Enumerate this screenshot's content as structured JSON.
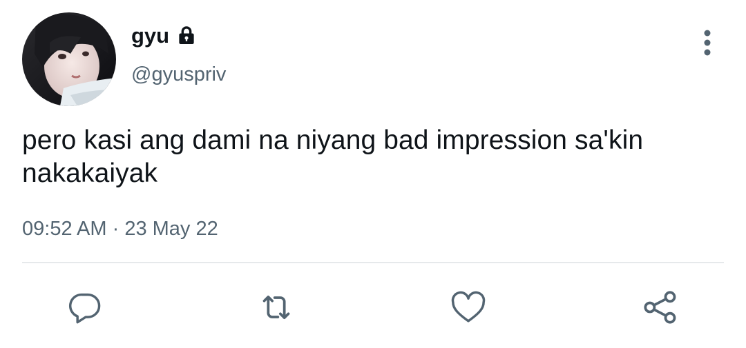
{
  "author": {
    "display_name": "gyu",
    "handle": "@gyuspriv",
    "protected": true,
    "avatar_icon": "avatar-photo"
  },
  "tweet": {
    "line1": "pero kasi ang dami na niyang bad impression sa'kin",
    "line2": "nakakaiyak"
  },
  "meta": {
    "time": "09:52 AM",
    "separator": " · ",
    "date": "23 May 22"
  },
  "actions": [
    {
      "icon": "reply-icon"
    },
    {
      "icon": "retweet-icon"
    },
    {
      "icon": "like-icon"
    },
    {
      "icon": "share-icon"
    }
  ],
  "colors": {
    "text_primary": "#0f1419",
    "text_secondary": "#536471",
    "icon": "#536471",
    "divider": "#e6e9eb"
  }
}
